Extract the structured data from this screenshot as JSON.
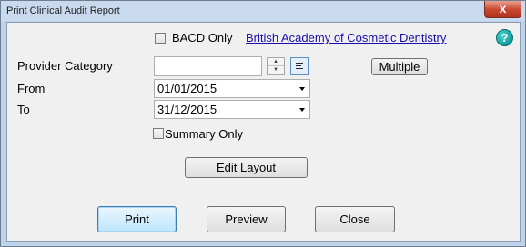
{
  "window": {
    "title": "Print Clinical Audit Report",
    "close_glyph": "x"
  },
  "bacd": {
    "checkbox_label": "BACD Only",
    "checked": false,
    "link_text": "British Academy of Cosmetic Dentistry"
  },
  "help": {
    "icon": "help-icon",
    "glyph": "?"
  },
  "provider_category": {
    "label": "Provider Category",
    "value": "",
    "spin_up_glyph": "▲",
    "spin_down_glyph": "▼",
    "list_icon": "list-icon",
    "multiple_label": "Multiple"
  },
  "from": {
    "label": "From",
    "value": "01/01/2015"
  },
  "to": {
    "label": "To",
    "value": "31/12/2015"
  },
  "summary": {
    "label": "Summary Only",
    "checked": false
  },
  "edit_layout_label": "Edit Layout",
  "buttons": {
    "print": "Print",
    "preview": "Preview",
    "close": "Close"
  }
}
